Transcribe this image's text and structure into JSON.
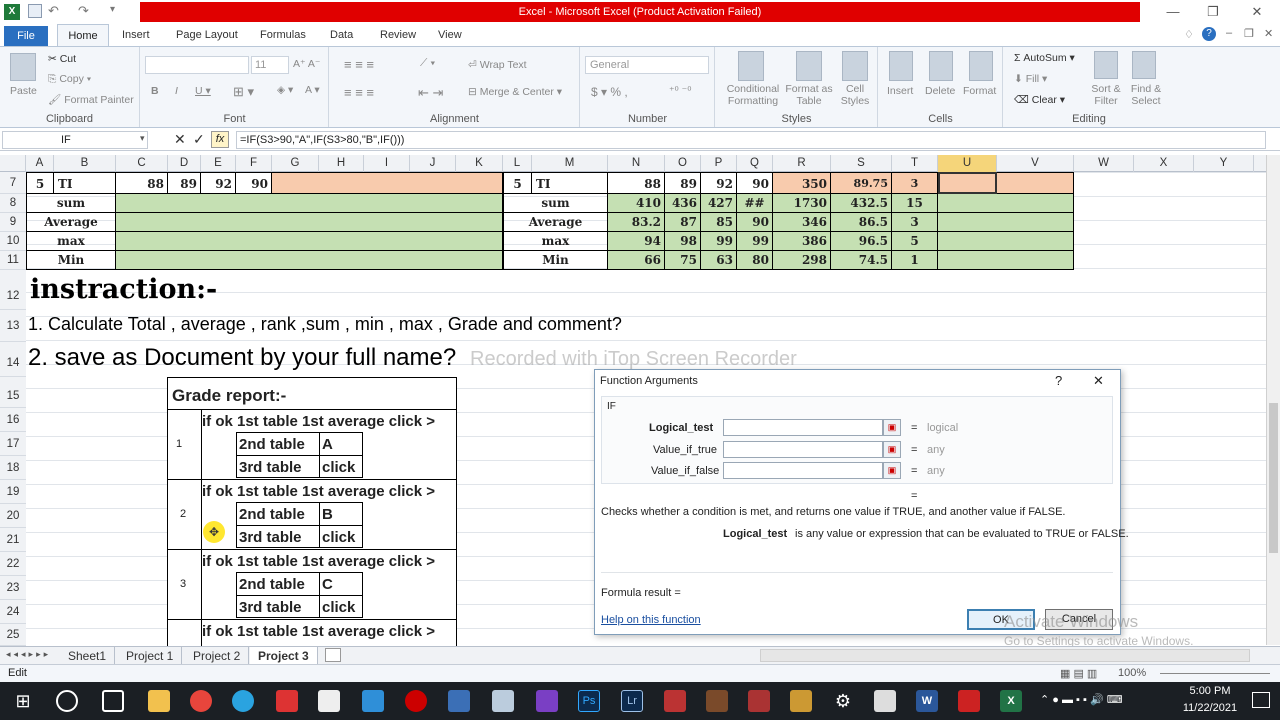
{
  "window": {
    "title": "Excel - Microsoft Excel (Product Activation Failed)"
  },
  "tabs": [
    "File",
    "Home",
    "Insert",
    "Page Layout",
    "Formulas",
    "Data",
    "Review",
    "View"
  ],
  "ribbon": {
    "clipboard": {
      "paste": "Paste",
      "cut": "Cut",
      "copy": "Copy",
      "format_painter": "Format Painter",
      "label": "Clipboard"
    },
    "font": {
      "size": "11",
      "label": "Font"
    },
    "alignment": {
      "wrap": "Wrap Text",
      "merge": "Merge & Center",
      "label": "Alignment"
    },
    "number": {
      "format": "General",
      "label": "Number"
    },
    "styles": {
      "cond": "Conditional Formatting",
      "table": "Format as Table",
      "cell": "Cell Styles",
      "label": "Styles"
    },
    "cells": {
      "insert": "Insert",
      "delete": "Delete",
      "format": "Format",
      "label": "Cells"
    },
    "editing": {
      "autosum": "AutoSum",
      "fill": "Fill",
      "clear": "Clear",
      "sort": "Sort & Filter",
      "find": "Find & Select",
      "label": "Editing"
    }
  },
  "formula_bar": {
    "name": "IF",
    "formula": "=IF(S3>90,\"A\",IF(S3>80,\"B\",IF()))"
  },
  "columns": [
    "A",
    "B",
    "C",
    "D",
    "E",
    "F",
    "G",
    "H",
    "I",
    "J",
    "K",
    "L",
    "M",
    "N",
    "O",
    "P",
    "Q",
    "R",
    "S",
    "T",
    "U",
    "V",
    "W",
    "X",
    "Y"
  ],
  "rows": [
    "7",
    "8",
    "9",
    "10",
    "11",
    "12",
    "13",
    "14",
    "15",
    "16",
    "17",
    "18",
    "19",
    "20",
    "21",
    "22",
    "23",
    "24",
    "25"
  ],
  "left_table": {
    "r7": [
      "5",
      "TI",
      "88",
      "89",
      "92",
      "90"
    ],
    "labels": [
      "sum",
      "Average",
      "max",
      "Min"
    ]
  },
  "right_table": {
    "r7": [
      "5",
      "TI",
      "88",
      "89",
      "92",
      "90",
      "350",
      "89.75",
      "3"
    ],
    "r8": [
      "sum",
      "410",
      "436",
      "427",
      "##",
      "1730",
      "432.5",
      "15"
    ],
    "r9": [
      "Average",
      "83.2",
      "87",
      "85",
      "90",
      "346",
      "86.5",
      "3"
    ],
    "r10": [
      "max",
      "94",
      "98",
      "99",
      "99",
      "386",
      "96.5",
      "5"
    ],
    "r11": [
      "Min",
      "66",
      "75",
      "63",
      "80",
      "298",
      "74.5",
      "1"
    ]
  },
  "instruction": {
    "heading": "instraction:-",
    "line1": "1. Calculate Total , average , rank ,sum , min , max , Grade and comment?",
    "line2": "2. save as Document by your full name?"
  },
  "watermark": "Recorded with iTop Screen Recorder",
  "grade_report": {
    "title": "Grade report:-",
    "blocks": [
      {
        "num": "1",
        "first": "if ok 1st table 1st average click >",
        "second": "2nd table",
        "grade": "A",
        "third": "3rd table",
        "click": "click"
      },
      {
        "num": "2",
        "first": "if ok 1st table 1st average click >",
        "second": "2nd table",
        "grade": "B",
        "third": "3rd table",
        "click": "click"
      },
      {
        "num": "3",
        "first": "if ok 1st table 1st average click >",
        "second": "2nd table",
        "grade": "C",
        "third": "3rd table",
        "click": "click"
      },
      {
        "first": "if ok 1st table 1st average click >"
      }
    ]
  },
  "dialog": {
    "title": "Function Arguments",
    "help_glyph": "?",
    "close_glyph": "✕",
    "func": "IF",
    "args": [
      {
        "name": "Logical_test",
        "value": "logical"
      },
      {
        "name": "Value_if_true",
        "value": "any"
      },
      {
        "name": "Value_if_false",
        "value": "any"
      }
    ],
    "eq": "=",
    "description": "Checks whether a condition is met, and returns one value if TRUE, and another value if FALSE.",
    "arg_name": "Logical_test",
    "arg_desc": "is any value or expression that can be evaluated to TRUE or FALSE.",
    "result": "Formula result =",
    "help_link": "Help on this function",
    "ok": "OK",
    "cancel": "Cancel"
  },
  "activate": {
    "line1": "Activate Windows",
    "line2": "Go to Settings to activate Windows."
  },
  "sheets": [
    "Sheet1",
    "Project 1",
    "Project 2",
    "Project 3"
  ],
  "status": {
    "mode": "Edit",
    "zoom": "100%"
  },
  "taskbar": {
    "time": "5:00 PM",
    "date": "11/22/2021"
  }
}
